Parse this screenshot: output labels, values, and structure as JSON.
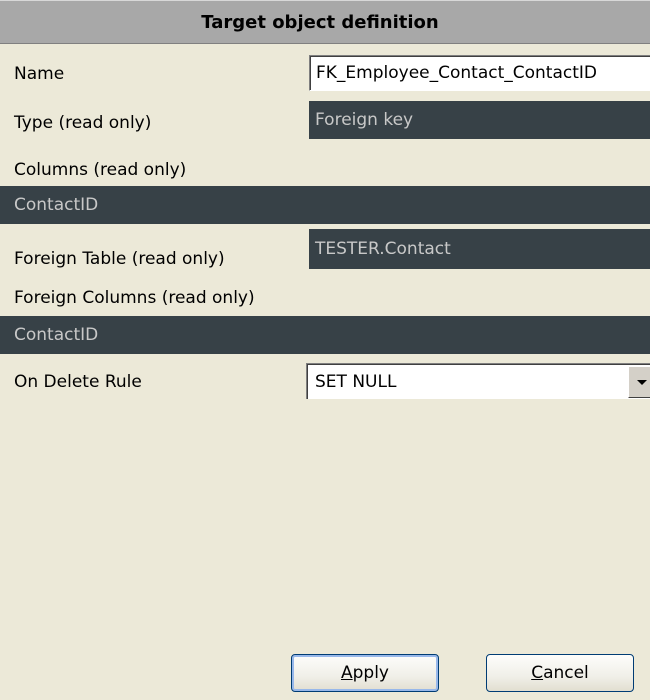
{
  "header": {
    "title": "Target object definition"
  },
  "fields": {
    "name": {
      "label": "Name",
      "value": "FK_Employee_Contact_ContactID"
    },
    "type": {
      "label": "Type (read only)",
      "value": "Foreign key"
    },
    "columns": {
      "label": "Columns (read only)",
      "value": "ContactID"
    },
    "foreign_table": {
      "label": "Foreign Table (read only)",
      "value": "TESTER.Contact"
    },
    "foreign_columns": {
      "label": "Foreign Columns (read only)",
      "value": "ContactID"
    },
    "on_delete": {
      "label": "On Delete Rule",
      "value": "SET NULL"
    }
  },
  "buttons": {
    "apply": {
      "mnemonic": "A",
      "rest": "pply"
    },
    "cancel": {
      "mnemonic": "C",
      "rest": "ancel"
    }
  },
  "colors": {
    "readonly_bg": "#374147",
    "readonly_text": "#c8c8c8",
    "header_bg": "#a8a8a8",
    "window_bg": "#ece9d8"
  },
  "icons": {
    "combo_dropdown": "chevron-down-icon"
  }
}
